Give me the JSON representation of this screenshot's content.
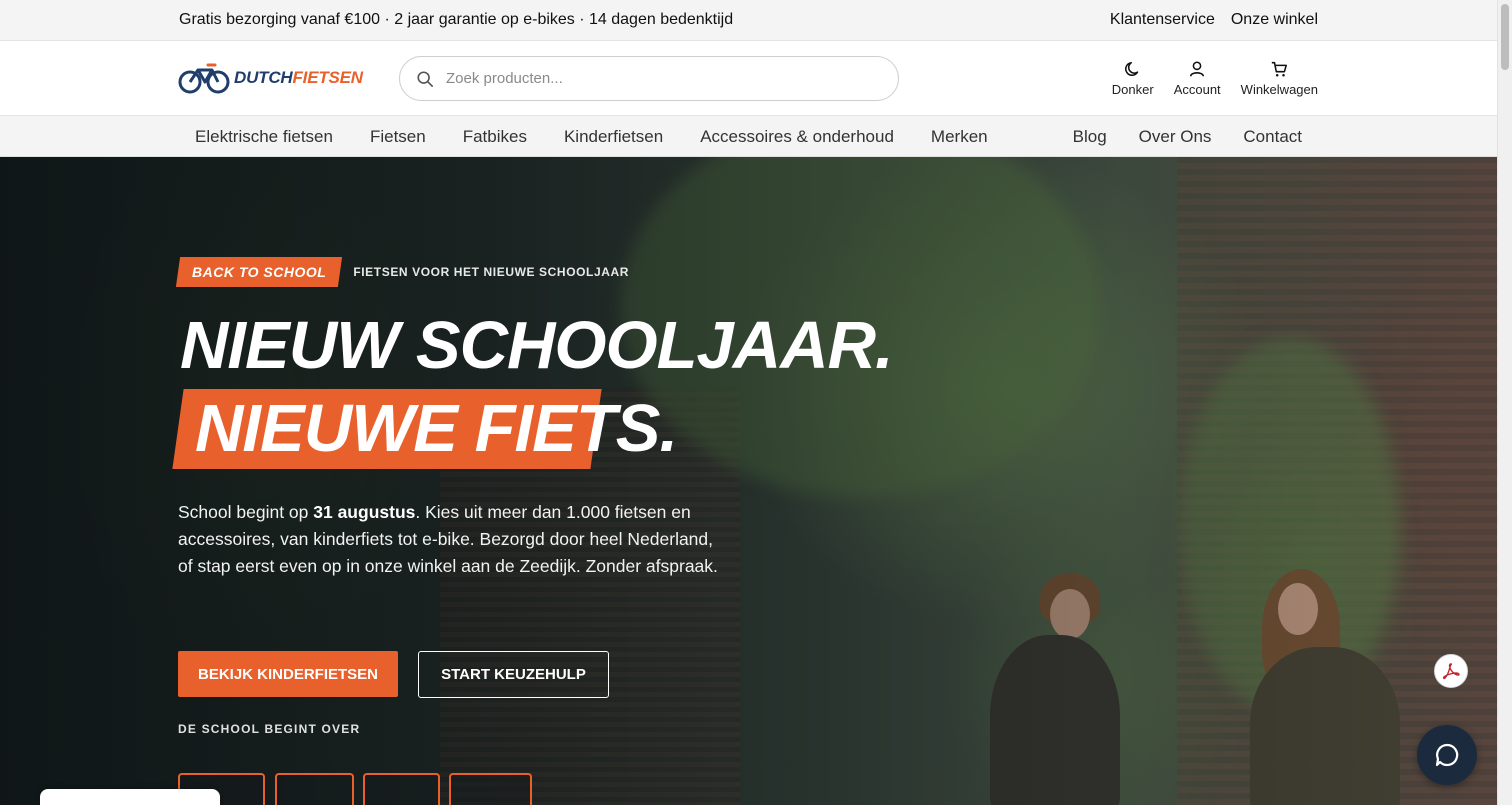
{
  "topbar": {
    "promo": "Gratis bezorging vanaf €100 · 2 jaar garantie op e-bikes · 14 dagen bedenktijd",
    "links": [
      "Klantenservice",
      "Onze winkel"
    ]
  },
  "header": {
    "logo": {
      "part1": "DUTCH",
      "part2": "FIETSEN"
    },
    "search_placeholder": "Zoek producten...",
    "actions": {
      "theme": "Donker",
      "account": "Account",
      "cart": "Winkelwagen"
    }
  },
  "nav": {
    "left": [
      "Elektrische fietsen",
      "Fietsen",
      "Fatbikes",
      "Kinderfietsen",
      "Accessoires & onderhoud",
      "Merken"
    ],
    "right": [
      "Blog",
      "Over Ons",
      "Contact"
    ]
  },
  "hero": {
    "badge": "BACK TO SCHOOL",
    "badge_sub": "FIETSEN VOOR HET NIEUWE SCHOOLJAAR",
    "headline1": "NIEUW SCHOOLJAAR.",
    "headline2": "NIEUWE FIETS.",
    "intro_pre": "School begint op ",
    "intro_bold": "31 augustus",
    "intro_post": ". Kies uit meer dan 1.000 fietsen en accessoires, van kinderfiets tot e-bike. Bezorgd door heel Nederland, of stap eerst even op in onze winkel aan de Zeedijk. Zonder afspraak.",
    "cta_primary": "BEKIJK KINDERFIETSEN",
    "cta_secondary": "START KEUZEHULP",
    "countdown_label": "DE SCHOOL BEGINT OVER"
  },
  "colors": {
    "accent": "#e8612c",
    "brand_dark": "#1f3e6b",
    "chat_bg": "#1c2a3e"
  },
  "icons": [
    "search-icon",
    "moon-icon",
    "user-icon",
    "cart-icon",
    "pdf-icon",
    "chat-icon"
  ]
}
